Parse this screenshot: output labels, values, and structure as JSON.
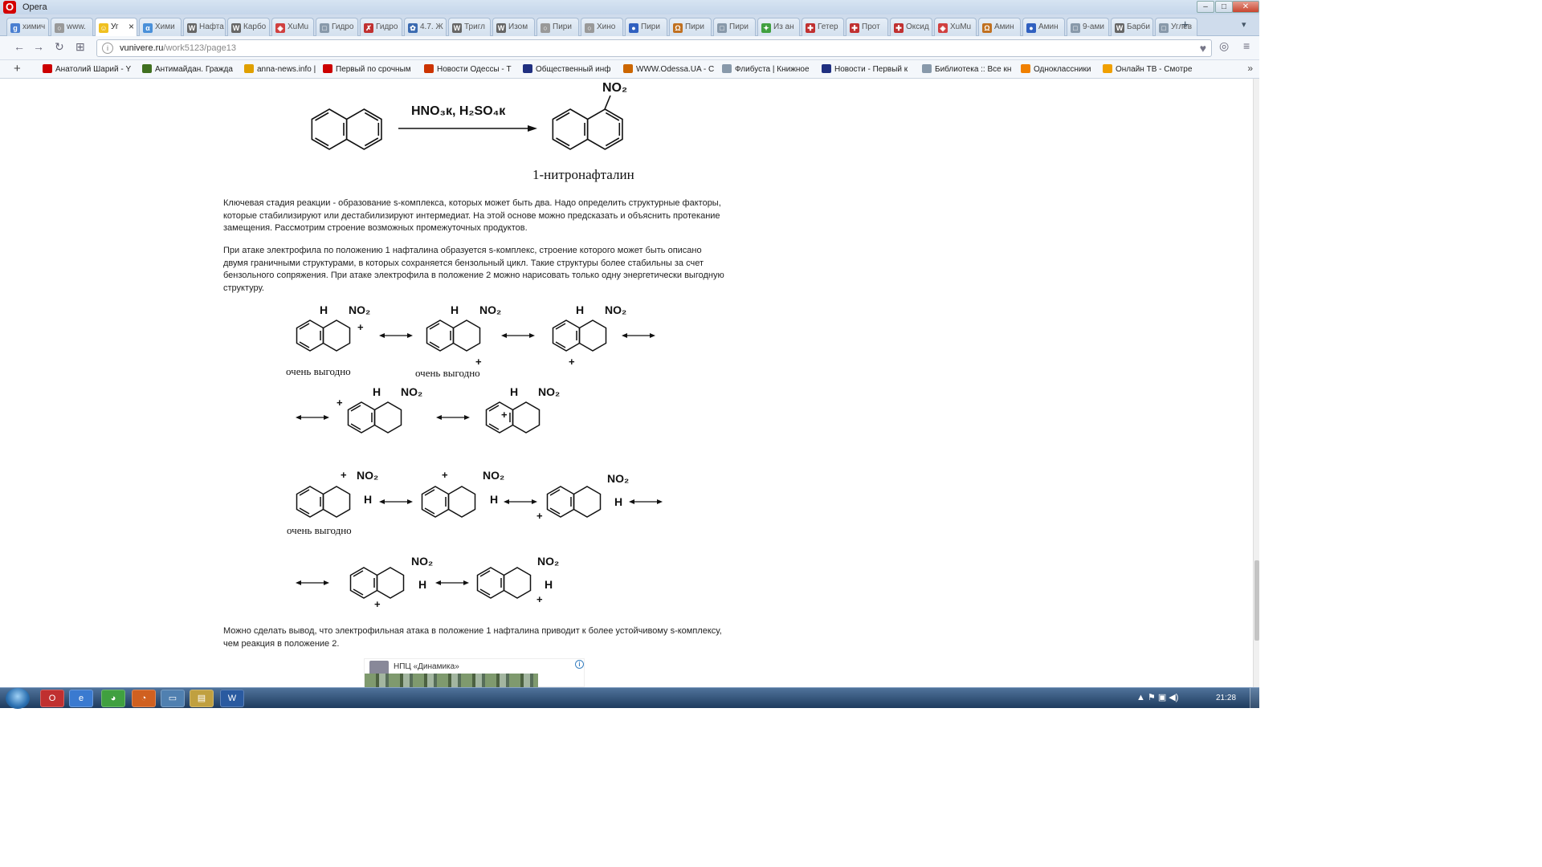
{
  "window": {
    "app_name": "Opera",
    "minimize": "–",
    "maximize": "□",
    "close": "✕"
  },
  "tabs": [
    {
      "label": "химич",
      "color": "#4a7fd1",
      "glyph": "g"
    },
    {
      "label": "www.",
      "color": "#999999",
      "glyph": "○"
    },
    {
      "label": "Уг",
      "color": "#f0c020",
      "glyph": "☺",
      "active": true
    },
    {
      "label": "Хими",
      "color": "#4a90d9",
      "glyph": "α"
    },
    {
      "label": "Нафта",
      "color": "#666666",
      "glyph": "W"
    },
    {
      "label": "Карбо",
      "color": "#666666",
      "glyph": "W"
    },
    {
      "label": "XuMu",
      "color": "#d04040",
      "glyph": "◈"
    },
    {
      "label": "Гидро",
      "color": "#8899aa",
      "glyph": "□"
    },
    {
      "label": "Гидро",
      "color": "#c03030",
      "glyph": "✗"
    },
    {
      "label": "4.7. Ж",
      "color": "#3a6ab0",
      "glyph": "✿"
    },
    {
      "label": "Тригл",
      "color": "#666666",
      "glyph": "W"
    },
    {
      "label": "Изом",
      "color": "#666666",
      "glyph": "W"
    },
    {
      "label": "Пири",
      "color": "#999999",
      "glyph": "○"
    },
    {
      "label": "Хино",
      "color": "#999999",
      "glyph": "○"
    },
    {
      "label": "Пири",
      "color": "#3060c0",
      "glyph": "●"
    },
    {
      "label": "Пири",
      "color": "#c07020",
      "glyph": "Ω"
    },
    {
      "label": "Пири",
      "color": "#8899aa",
      "glyph": "□"
    },
    {
      "label": "Из ан",
      "color": "#40a040",
      "glyph": "✦"
    },
    {
      "label": "Гетер",
      "color": "#c03030",
      "glyph": "✚"
    },
    {
      "label": "Прот",
      "color": "#c03030",
      "glyph": "✚"
    },
    {
      "label": "Оксид",
      "color": "#c03030",
      "glyph": "✚"
    },
    {
      "label": "XuMu",
      "color": "#d04040",
      "glyph": "◈"
    },
    {
      "label": "Амин",
      "color": "#c07020",
      "glyph": "Ω"
    },
    {
      "label": "Амин",
      "color": "#3060c0",
      "glyph": "●"
    },
    {
      "label": "9-ами",
      "color": "#8899aa",
      "glyph": "□"
    },
    {
      "label": "Барби",
      "color": "#666666",
      "glyph": "W"
    },
    {
      "label": "Углев",
      "color": "#8899aa",
      "glyph": "□"
    }
  ],
  "new_tab": "+",
  "tab_overflow": "▾",
  "nav": {
    "back": "←",
    "forward": "→",
    "reload": "↻",
    "speed_dial": "⊞",
    "url_domain": "vunivere.ru",
    "url_path": "/work5123/page13",
    "heart": "♥",
    "sync": "◎",
    "menu": "≡"
  },
  "bookmarks": [
    {
      "label": "Анатолий Шарий - Y",
      "color": "#cc0000"
    },
    {
      "label": "Антимайдан. Гражда",
      "color": "#407020"
    },
    {
      "label": "anna-news.info |",
      "color": "#e0a000"
    },
    {
      "label": "Первый по срочным",
      "color": "#cc0000"
    },
    {
      "label": "Новости Одессы - Т",
      "color": "#cc3300"
    },
    {
      "label": "Общественный инф",
      "color": "#203080"
    },
    {
      "label": "WWW.Odessa.UA - С",
      "color": "#cc6600"
    },
    {
      "label": "Флибуста | Книжное",
      "color": "#8899aa"
    },
    {
      "label": "Новости - Первый к",
      "color": "#203080"
    },
    {
      "label": "Библиотека :: Все кн",
      "color": "#8899aa"
    },
    {
      "label": "Одноклассники",
      "color": "#f08000"
    },
    {
      "label": "Онлайн ТВ - Смотре",
      "color": "#f0a000"
    }
  ],
  "bookmarks_plus": "+",
  "bookmarks_more": "»",
  "reaction1": {
    "conditions": "HNO₃к, H₂SO₄к",
    "product_group": "NO₂",
    "product_name": "1-нитронафталин"
  },
  "paragraphs": {
    "p1": "Ключевая стадия реакции - образование s-комплекса, которых может быть два. Надо определить структурные факторы, которые стабилизируют или дестабилизируют интермедиат. На этой основе можно предсказать и объяснить протекание замещения. Рассмотрим строение возможных промежуточных продуктов.",
    "p2": "При атаке электрофила по положению 1 нафталина образуется s-комплекс, строение которого может быть описано двумя граничными структурами, в которых сохраняется бензольный цикл. Такие структуры более стабильны за счет бензольного сопряжения. При атаке электрофила в положение 2 можно нарисовать только одну энергетически выгодную структуру.",
    "p3": "Можно сделать вывод, что электрофильная атака в положение 1 нафталина приводит к более устойчивому s-комплексу, чем реакция в положение 2."
  },
  "sigma": {
    "h": "H",
    "no2": "NO₂",
    "plus": "+",
    "very_favorable_1": "очень выгодно",
    "very_favorable_2": "очень выгодно",
    "very_favorable_3": "очень выгодно"
  },
  "ad": {
    "title": "НПЦ «Динамика»",
    "info": "i"
  },
  "taskbar": {
    "apps": [
      "O",
      "e",
      "◕",
      "◔",
      "▭",
      "▤",
      "W"
    ],
    "tray": "▲  ⚑  ▣  ◀)",
    "clock": "21:28"
  }
}
